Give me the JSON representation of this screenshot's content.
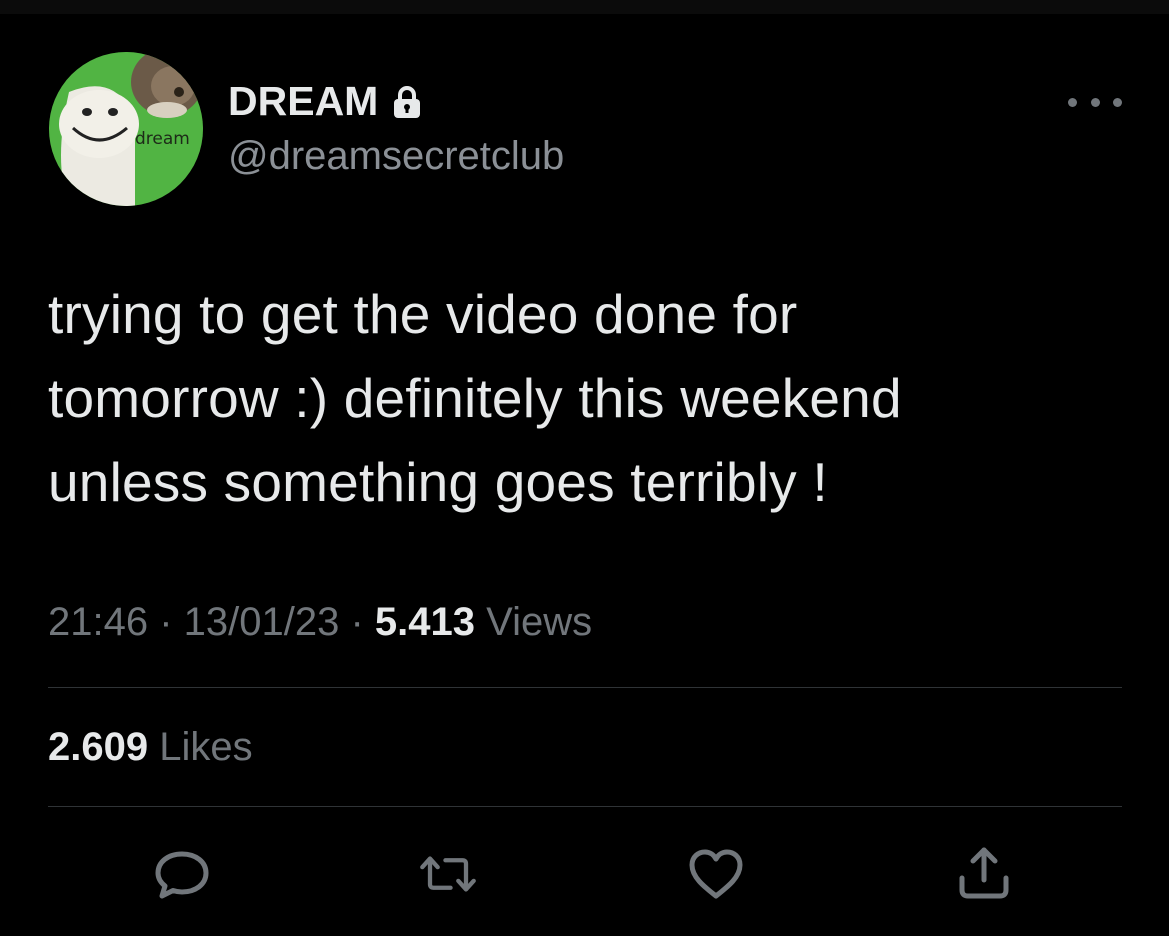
{
  "author": {
    "display_name": "DREAM",
    "handle": "@dreamsecretclub",
    "avatar_label": "dream",
    "verified_icon": "lock-icon"
  },
  "tweet": {
    "lines": [
      "trying to get the video done for",
      "tomorrow :) definitely this weekend",
      "unless something goes terribly !"
    ]
  },
  "meta": {
    "time": "21:46",
    "separator": " · ",
    "date": "13/01/23",
    "views_count": "5.413",
    "views_label": " Views"
  },
  "stats": {
    "likes_count": "2.609",
    "likes_label": " Likes"
  },
  "actions": [
    {
      "icon": "reply-icon"
    },
    {
      "icon": "retweet-icon"
    },
    {
      "icon": "like-icon"
    },
    {
      "icon": "share-icon"
    }
  ],
  "colors": {
    "background": "#000000",
    "text_primary": "#e7e9ea",
    "text_secondary": "#71767b",
    "divider": "#2f3336",
    "avatar_green": "#4caf3f"
  }
}
